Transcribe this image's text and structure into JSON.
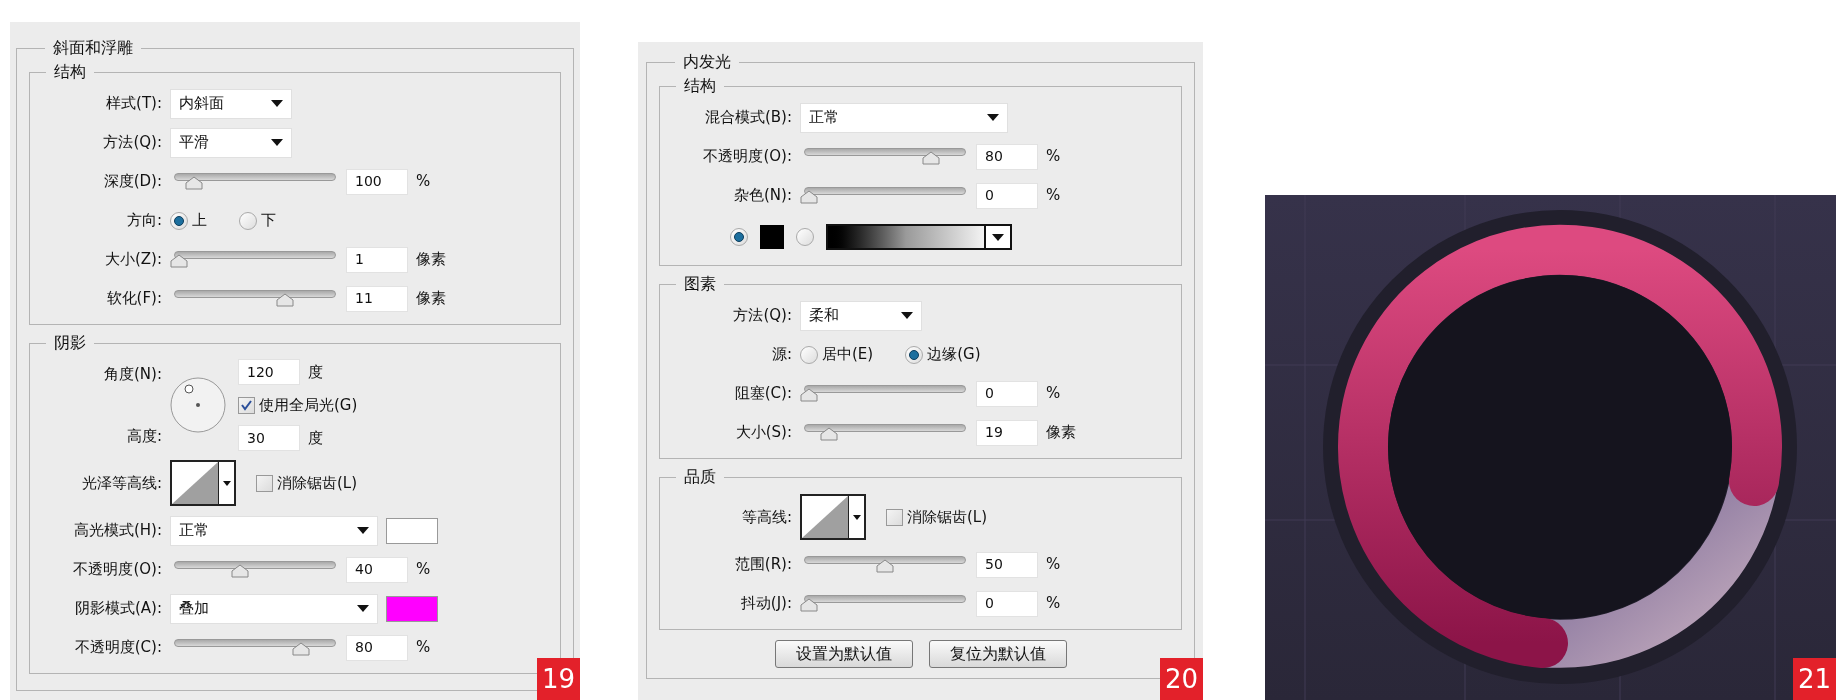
{
  "panels": [
    {
      "kind": "dialog",
      "title": "斜面和浮雕",
      "badge": "19",
      "sections": [
        {
          "title": "结构",
          "rows": [
            {
              "kind": "select",
              "label": "样式(T):",
              "value": "内斜面"
            },
            {
              "kind": "select",
              "label": "方法(Q):",
              "value": "平滑"
            },
            {
              "kind": "slider",
              "label": "深度(D):",
              "level": 0.1,
              "value": "100",
              "unit": "%"
            },
            {
              "kind": "radio",
              "label": "方向:",
              "options": [
                {
                  "label": "上",
                  "selected": true
                },
                {
                  "label": "下",
                  "selected": false
                }
              ]
            },
            {
              "kind": "slider",
              "label": "大小(Z):",
              "level": 0,
              "value": "1",
              "unit": "像素"
            },
            {
              "kind": "slider",
              "label": "软化(F):",
              "level": 0.7,
              "value": "11",
              "unit": "像素"
            }
          ]
        },
        {
          "title": "阴影",
          "rows": [
            {
              "kind": "angle",
              "label": "角度(N):",
              "value": "120",
              "unit": "度",
              "checkbox": {
                "label": "使用全局光(G)",
                "checked": true
              },
              "altitude_label": "高度:",
              "altitude_value": "30",
              "altitude_unit": "度"
            },
            {
              "kind": "contour",
              "label": "光泽等高线:",
              "checkbox": {
                "label": "消除锯齿(L)",
                "checked": false
              }
            },
            {
              "kind": "wide-select",
              "label": "高光模式(H):",
              "value": "正常",
              "color": "#ffffff"
            },
            {
              "kind": "slider",
              "label": "不透明度(O):",
              "level": 0.4,
              "value": "40",
              "unit": "%"
            },
            {
              "kind": "wide-select",
              "label": "阴影模式(A):",
              "value": "叠加",
              "color": "#ff00ff"
            },
            {
              "kind": "slider",
              "label": "不透明度(C):",
              "level": 0.8,
              "value": "80",
              "unit": "%"
            }
          ]
        }
      ]
    },
    {
      "kind": "dialog",
      "title": "内发光",
      "badge": "20",
      "sections": [
        {
          "title": "结构",
          "rows": [
            {
              "kind": "wide-select",
              "label": "混合模式(B):",
              "value": "正常"
            },
            {
              "kind": "slider",
              "label": "不透明度(O):",
              "level": 0.8,
              "value": "80",
              "unit": "%"
            },
            {
              "kind": "slider",
              "label": "杂色(N):",
              "level": 0,
              "value": "0",
              "unit": "%"
            },
            {
              "kind": "fill",
              "options": [
                {
                  "kind": "swatch",
                  "color": "#000000",
                  "selected": true
                },
                {
                  "kind": "gradient",
                  "selected": false
                }
              ]
            }
          ]
        },
        {
          "title": "图素",
          "rows": [
            {
              "kind": "select",
              "label": "方法(Q):",
              "value": "柔和"
            },
            {
              "kind": "radio",
              "label": "源:",
              "options": [
                {
                  "label": "居中(E)",
                  "selected": false
                },
                {
                  "label": "边缘(G)",
                  "selected": true
                }
              ]
            },
            {
              "kind": "slider",
              "label": "阻塞(C):",
              "level": 0,
              "value": "0",
              "unit": "%"
            },
            {
              "kind": "slider",
              "label": "大小(S):",
              "level": 0.13,
              "value": "19",
              "unit": "像素"
            }
          ]
        },
        {
          "title": "品质",
          "rows": [
            {
              "kind": "contour",
              "label": "等高线:",
              "checkbox": {
                "label": "消除锯齿(L)",
                "checked": false
              }
            },
            {
              "kind": "slider",
              "label": "范围(R):",
              "level": 0.5,
              "value": "50",
              "unit": "%"
            },
            {
              "kind": "slider",
              "label": "抖动(J):",
              "level": 0,
              "value": "0",
              "unit": "%"
            }
          ]
        }
      ],
      "buttons": [
        "设置为默认值",
        "复位为默认值"
      ]
    },
    {
      "kind": "picture",
      "badge": "21"
    }
  ]
}
